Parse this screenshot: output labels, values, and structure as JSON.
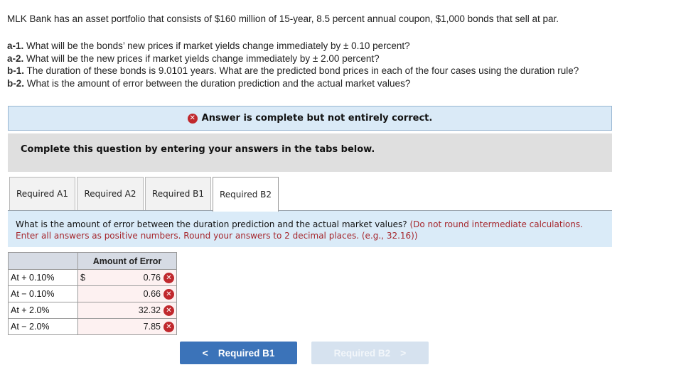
{
  "problem": {
    "intro": "MLK Bank has an asset portfolio that consists of $160 million of 15-year, 8.5 percent annual coupon, $1,000 bonds that sell at par.",
    "questions": [
      {
        "label": "a-1.",
        "text": " What will be the bonds’ new prices if market yields change immediately by ± 0.10 percent?"
      },
      {
        "label": "a-2.",
        "text": " What will be the new prices if market yields change immediately by ± 2.00 percent?"
      },
      {
        "label": "b-1.",
        "text": " The duration of these bonds is 9.0101 years. What are the predicted bond prices in each of the four cases using the duration rule?"
      },
      {
        "label": "b-2.",
        "text": " What is the amount of error between the duration prediction and the actual market values?"
      }
    ]
  },
  "status": {
    "icon": "incorrect-x-icon",
    "message": "Answer is complete but not entirely correct.",
    "color": "#c0282d"
  },
  "instructions": "Complete this question by entering your answers in the tabs below.",
  "tabs": [
    {
      "label": "Required A1",
      "active": false
    },
    {
      "label": "Required A2",
      "active": false
    },
    {
      "label": "Required B1",
      "active": false
    },
    {
      "label": "Required B2",
      "active": true
    }
  ],
  "prompt": {
    "question": "What is the amount of error between the duration prediction and the actual market values?",
    "note": "(Do not round intermediate calculations. Enter all answers as positive numbers. Round your answers to 2 decimal places. (e.g., 32.16))"
  },
  "table": {
    "header": "Amount of Error",
    "currency_symbol": "$",
    "rows": [
      {
        "label": "At + 0.10%",
        "value": "0.76",
        "status": "incorrect"
      },
      {
        "label": "At − 0.10%",
        "value": "0.66",
        "status": "incorrect"
      },
      {
        "label": "At + 2.0%",
        "value": "32.32",
        "status": "incorrect"
      },
      {
        "label": "At − 2.0%",
        "value": "7.85",
        "status": "incorrect"
      }
    ]
  },
  "navigation": {
    "prev_label": "Required B1",
    "next_label": "Required B2",
    "prev_icon": "chevron-left-icon",
    "next_icon": "chevron-right-icon",
    "next_disabled": true
  },
  "colors": {
    "accent": "#3b73b9",
    "error": "#c0282d",
    "banner_bg": "#daeaf7",
    "note_text": "#a5262c"
  }
}
